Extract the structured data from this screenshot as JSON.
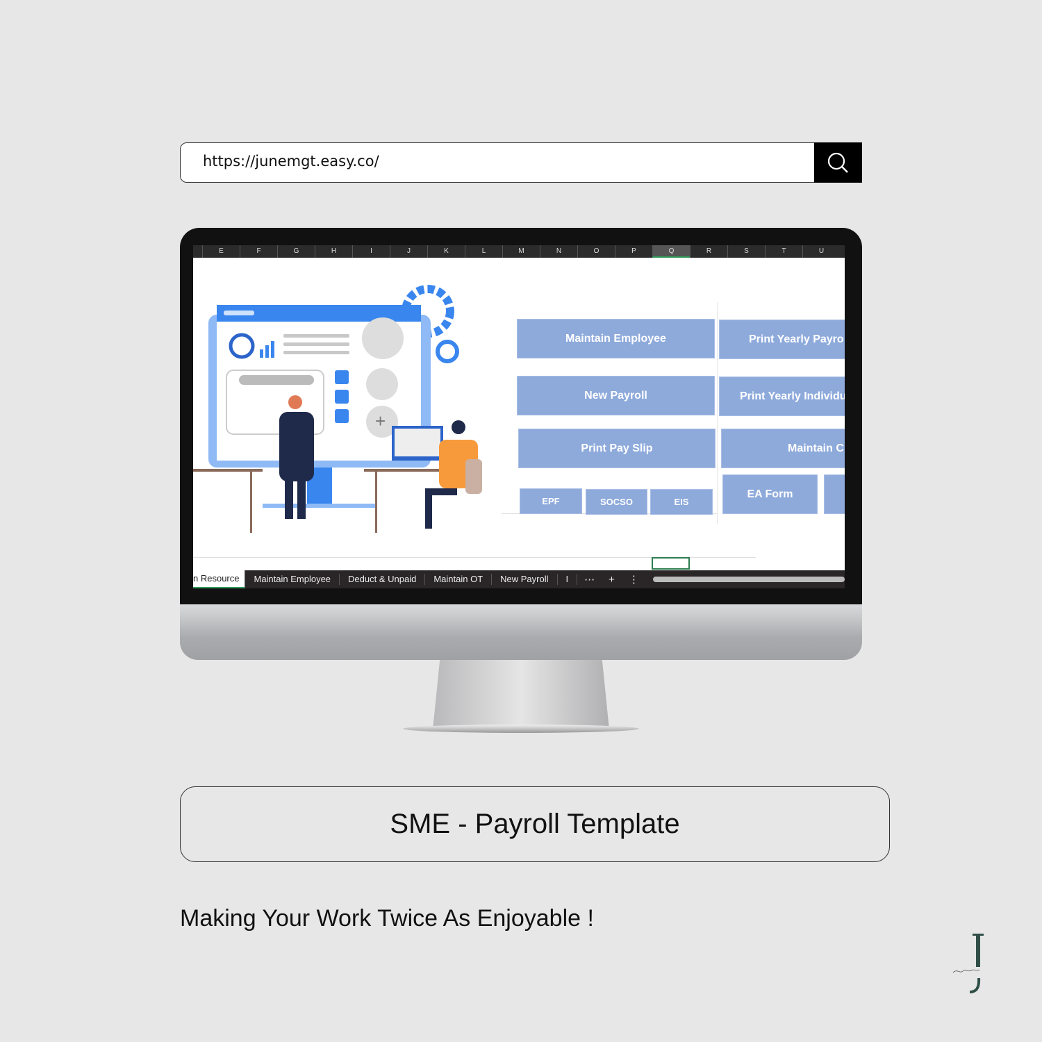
{
  "url_bar": {
    "value": "https://junemgt.easy.co/",
    "search_icon": "search-icon"
  },
  "spreadsheet": {
    "columns": [
      "E",
      "F",
      "G",
      "H",
      "I",
      "J",
      "K",
      "L",
      "M",
      "N",
      "O",
      "P",
      "Q",
      "R",
      "S",
      "T",
      "U"
    ],
    "selected_column": "Q",
    "buttons": {
      "maintain_employee": "Maintain Employee",
      "print_yearly_payroll": "Print Yearly Payro",
      "new_payroll": "New Payroll",
      "print_yearly_individual": "Print Yearly Individu",
      "print_pay_slip": "Print Pay Slip",
      "maintain_c": "Maintain C",
      "epf": "EPF",
      "socso": "SOCSO",
      "eis": "EIS",
      "ea_form": "EA Form"
    },
    "button_color": "#8eaadb",
    "sheet_tabs": [
      "n Resource",
      "Maintain Employee",
      "Deduct & Unpaid",
      "Maintain OT",
      "New Payroll",
      "I"
    ],
    "active_tab": "n Resource"
  },
  "title": "SME - Payroll Template",
  "tagline": "Making Your Work Twice As Enjoyable !",
  "logo": {
    "letter": "J",
    "script": "Junece"
  }
}
